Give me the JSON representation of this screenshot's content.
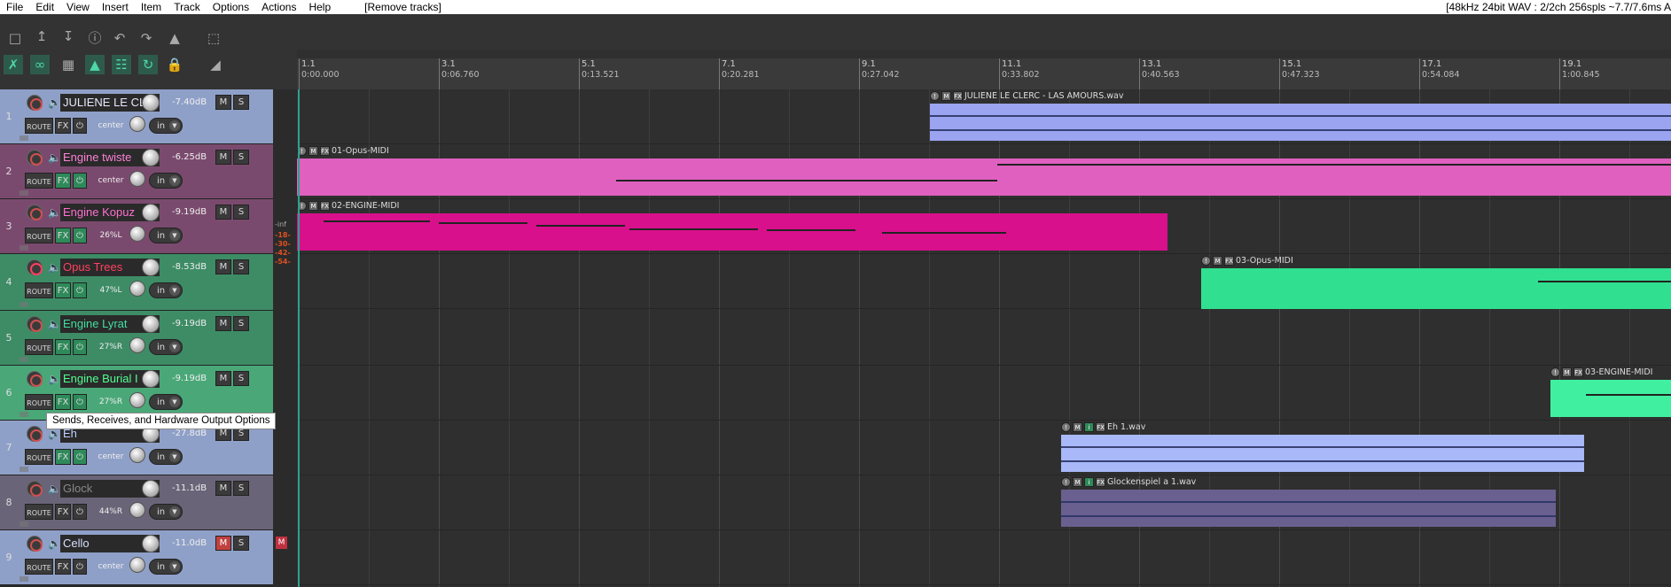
{
  "menubar": {
    "items": [
      "File",
      "Edit",
      "View",
      "Insert",
      "Item",
      "Track",
      "Options",
      "Actions",
      "Help"
    ],
    "action_hint": "[Remove tracks]",
    "status": "[48kHz 24bit WAV : 2/2ch 256spls ~7.7/7.6ms A"
  },
  "tooltip": "Sends, Receives, and Hardware Output Options",
  "ruler": {
    "marks": [
      {
        "bar": "1.1",
        "time": "0:00.000"
      },
      {
        "bar": "3.1",
        "time": "0:06.760"
      },
      {
        "bar": "5.1",
        "time": "0:13.521"
      },
      {
        "bar": "7.1",
        "time": "0:20.281"
      },
      {
        "bar": "9.1",
        "time": "0:27.042"
      },
      {
        "bar": "11.1",
        "time": "0:33.802"
      },
      {
        "bar": "13.1",
        "time": "0:40.563"
      },
      {
        "bar": "15.1",
        "time": "0:47.323"
      },
      {
        "bar": "17.1",
        "time": "0:54.084"
      },
      {
        "bar": "19.1",
        "time": "1:00.845"
      }
    ]
  },
  "tracks": [
    {
      "num": "1",
      "name": "JULIENE LE CLE",
      "db": "-7.40dB",
      "pan": "center",
      "route": "ROUTE",
      "fx": "FX",
      "in": "in",
      "m": "M",
      "s": "S",
      "color": "#8fa0c8",
      "namecolor": "#e8e8ff"
    },
    {
      "num": "2",
      "name": "Engine twiste",
      "db": "-6.25dB",
      "pan": "center",
      "route": "ROUTE",
      "fx": "FX",
      "in": "in",
      "m": "M",
      "s": "S",
      "color": "#7a4a6e",
      "namecolor": "#ff80d8"
    },
    {
      "num": "3",
      "name": "Engine Kopuz",
      "db": "-9.19dB",
      "pan": "26%L",
      "route": "ROUTE",
      "fx": "FX",
      "in": "in",
      "m": "M",
      "s": "S",
      "color": "#7a4a6e",
      "namecolor": "#ff70d0"
    },
    {
      "num": "4",
      "name": "Opus Trees",
      "db": "-8.53dB",
      "pan": "47%L",
      "route": "ROUTE",
      "fx": "FX",
      "in": "in",
      "m": "M",
      "s": "S",
      "color": "#3d8c66",
      "namecolor": "#ff4060"
    },
    {
      "num": "5",
      "name": "Engine Lyrat",
      "db": "-9.19dB",
      "pan": "27%R",
      "route": "ROUTE",
      "fx": "FX",
      "in": "in",
      "m": "M",
      "s": "S",
      "color": "#3d8c66",
      "namecolor": "#40e0a0"
    },
    {
      "num": "6",
      "name": "Engine Burial I",
      "db": "-9.19dB",
      "pan": "27%R",
      "route": "ROUTE",
      "fx": "FX",
      "in": "in",
      "m": "M",
      "s": "S",
      "color": "#4aa878",
      "namecolor": "#50ff90"
    },
    {
      "num": "7",
      "name": "Eh",
      "db": "-27.8dB",
      "pan": "center",
      "route": "ROUTE",
      "fx": "FX",
      "in": "in",
      "m": "M",
      "s": "S",
      "color": "#8fa0c8",
      "namecolor": "#c0d0ff"
    },
    {
      "num": "8",
      "name": "Glock",
      "db": "-11.1dB",
      "pan": "44%R",
      "route": "ROUTE",
      "fx": "FX",
      "in": "in",
      "m": "M",
      "s": "S",
      "color": "#6a6478",
      "namecolor": "#888888"
    },
    {
      "num": "9",
      "name": "Cello",
      "db": "-11.0dB",
      "pan": "center",
      "route": "ROUTE",
      "fx": "FX",
      "in": "in",
      "m": "M",
      "s": "S",
      "color": "#8fa0c8",
      "namecolor": "#d8e0ff"
    }
  ],
  "meters": {
    "inf": "-inf",
    "levels": [
      "-18-",
      "-30-",
      "-42-",
      "-54-"
    ],
    "mute_badge": "M"
  },
  "items": [
    {
      "name": "JULIENE LE CLERC - LAS AMOURS.wav",
      "color": "#9aa4f0"
    },
    {
      "name": "01-Opus-MIDI",
      "color": "#e060c0"
    },
    {
      "name": "02-ENGINE-MIDI",
      "color": "#d8108c"
    },
    {
      "name": "03-Opus-MIDI",
      "color": "#30e090"
    },
    {
      "name": "03-ENGINE-MIDI",
      "color": "#40f0a0"
    },
    {
      "name": "Eh 1.wav",
      "color": "#a8b8f8"
    },
    {
      "name": "Glockenspiel a 1.wav",
      "color": "#6a6090"
    }
  ],
  "icons": [
    "new-project-icon",
    "open-project-icon",
    "save-project-icon",
    "project-settings-icon",
    "undo-icon",
    "redo-icon",
    "metronome-icon",
    "marquee-icon",
    "ripple-icon",
    "link-icon",
    "snap-grid-icon",
    "lock-icon",
    "envelope-icon"
  ]
}
